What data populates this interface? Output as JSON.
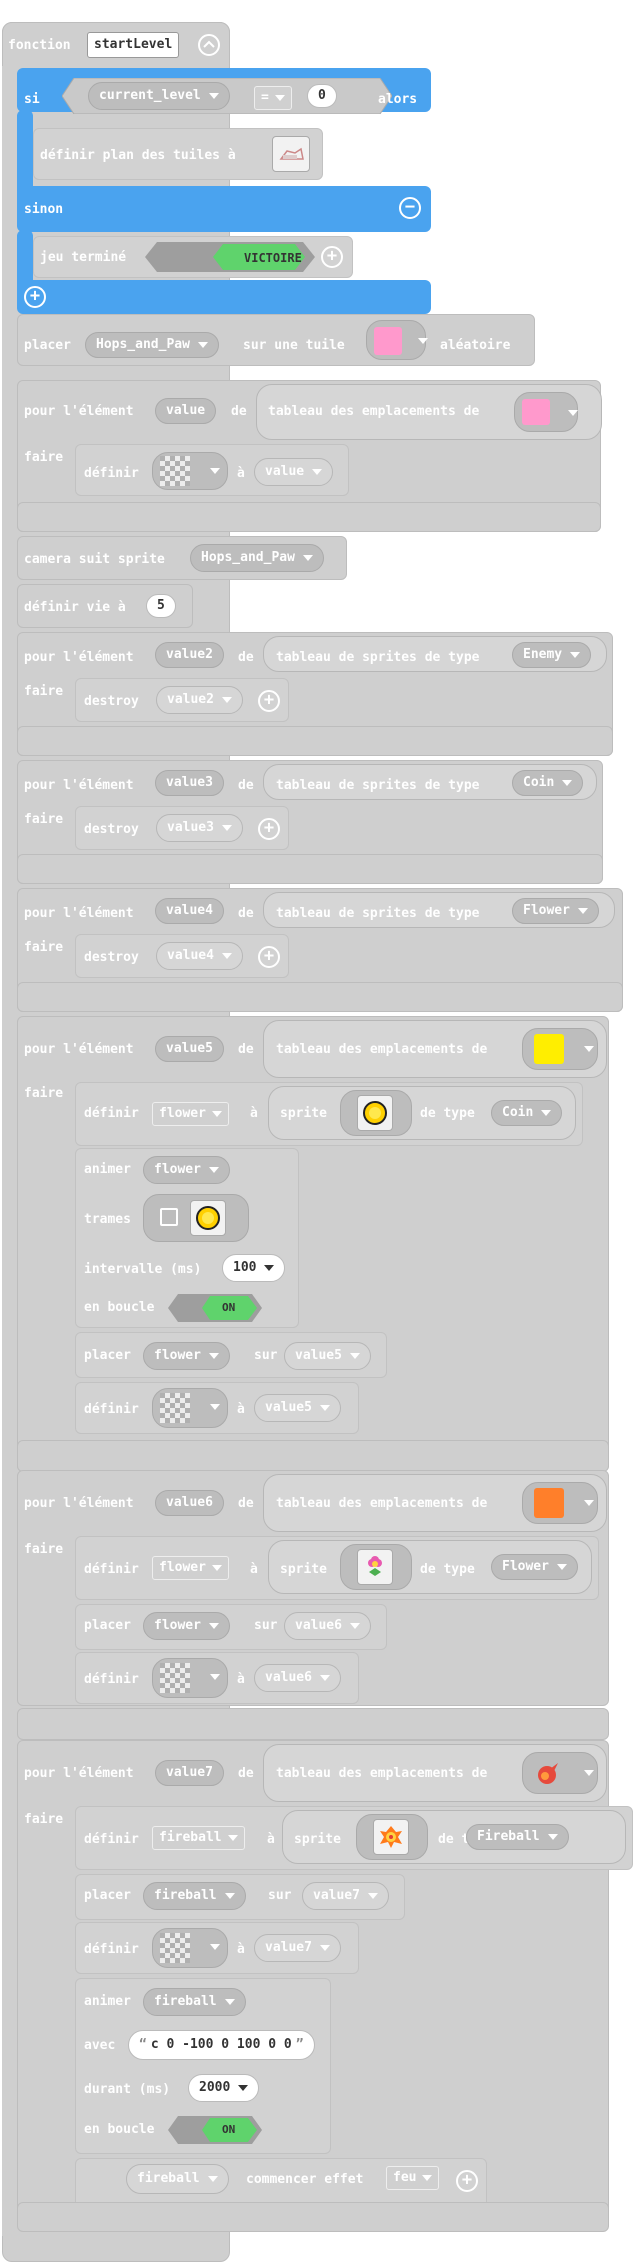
{
  "colors": {
    "block_gray": "#cfcfcf",
    "block_blue": "#4aa3ef",
    "toggle_green": "#5fd36c",
    "pink": "#ff99cc",
    "yellow": "#ffee00",
    "orange": "#ff7f2a"
  },
  "func": {
    "keyword": "fonction",
    "name": "startLevel"
  },
  "ifblock": {
    "si": "si",
    "var": "current_level",
    "op": "=",
    "value": "0",
    "alors": "alors",
    "set_tilemap": "définir plan des tuiles à",
    "sinon": "sinon",
    "game_over": "jeu terminé",
    "victoire": "VICTOIRE"
  },
  "place1": {
    "placer": "placer",
    "sprite": "Hops_and_Paw",
    "sur": "sur une tuile",
    "random": "aléatoire"
  },
  "loop1": {
    "pour": "pour l'élément",
    "var": "value",
    "de": "de",
    "src": "tableau des emplacements de",
    "faire": "faire",
    "set": "définir",
    "a": "à",
    "val": "value"
  },
  "camera": {
    "text": "camera suit sprite",
    "sprite": "Hops_and_Paw"
  },
  "life": {
    "text": "définir vie à",
    "value": "5"
  },
  "loop2": {
    "pour": "pour l'élément",
    "var": "value2",
    "de": "de",
    "src": "tableau de sprites de type",
    "kind": "Enemy",
    "faire": "faire",
    "destroy": "destroy",
    "val": "value2"
  },
  "loop3": {
    "pour": "pour l'élément",
    "var": "value3",
    "de": "de",
    "src": "tableau de sprites de type",
    "kind": "Coin",
    "faire": "faire",
    "destroy": "destroy",
    "val": "value3"
  },
  "loop4": {
    "pour": "pour l'élément",
    "var": "value4",
    "de": "de",
    "src": "tableau de sprites de type",
    "kind": "Flower",
    "faire": "faire",
    "destroy": "destroy",
    "val": "value4"
  },
  "loop5": {
    "pour": "pour l'élément",
    "var": "value5",
    "de": "de",
    "src": "tableau des emplacements de",
    "faire": "faire",
    "set": "définir",
    "spritevar": "flower",
    "a": "à",
    "sprite": "sprite",
    "detype": "de type",
    "kind": "Coin",
    "animer": "animer",
    "anim_var": "flower",
    "trames": "trames",
    "interval_label": "intervalle (ms)",
    "interval": "100",
    "loop_label": "en boucle",
    "on": "ON",
    "placer": "placer",
    "sur": "sur",
    "val": "value5"
  },
  "loop6": {
    "pour": "pour l'élément",
    "var": "value6",
    "de": "de",
    "src": "tableau des emplacements de",
    "faire": "faire",
    "set": "définir",
    "spritevar": "flower",
    "a": "à",
    "sprite": "sprite",
    "detype": "de type",
    "kind": "Flower",
    "placer": "placer",
    "sur": "sur",
    "val": "value6"
  },
  "loop7": {
    "pour": "pour l'élément",
    "var": "value7",
    "de": "de",
    "src": "tableau des emplacements de",
    "faire": "faire",
    "set": "définir",
    "spritevar": "fireball",
    "a": "à",
    "sprite": "sprite",
    "detype": "de type",
    "kind": "Fireball",
    "placer": "placer",
    "sur": "sur",
    "val": "value7",
    "animer": "animer",
    "anim_var": "fireball",
    "avec": "avec",
    "path": "c 0 -100 0 100 0 0",
    "durant": "durant (ms)",
    "duration": "2000",
    "loop_label": "en boucle",
    "on": "ON",
    "effect_var": "fireball",
    "effect_text": "commencer effet",
    "effect": "feu"
  }
}
